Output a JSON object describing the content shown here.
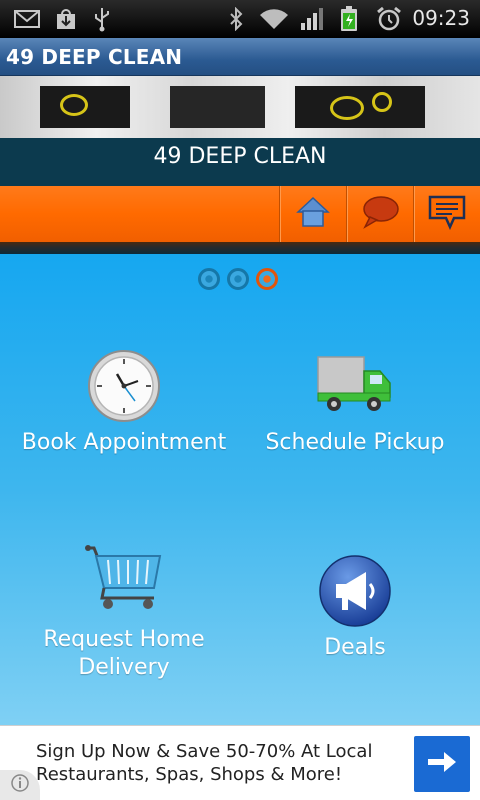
{
  "status_bar": {
    "icons": [
      "gmail-icon",
      "download-icon",
      "usb-icon",
      "bluetooth-icon",
      "wifi-icon",
      "signal-icon",
      "battery-charging-icon",
      "alarm-icon"
    ],
    "time": "09:23"
  },
  "app": {
    "title": "49 DEEP CLEAN"
  },
  "banner": {
    "business_name": "49 DEEP CLEAN"
  },
  "toolbar": {
    "buttons": [
      "home-icon",
      "chat-bubble-icon",
      "message-icon"
    ]
  },
  "pager": {
    "count": 3,
    "active_index": 2
  },
  "menu": {
    "items": [
      {
        "label": "Book Appointment",
        "icon": "clock-icon"
      },
      {
        "label": "Schedule Pickup",
        "icon": "truck-icon"
      },
      {
        "label": "Request Home Delivery",
        "icon": "shopping-cart-icon"
      },
      {
        "label": "Deals",
        "icon": "megaphone-icon"
      }
    ]
  },
  "ad": {
    "text": "Sign Up Now & Save 50-70% At Local Restaurants, Spas, Shops & More!"
  },
  "colors": {
    "title_bar": "#2b5a92",
    "toolbar_orange": "#ff6a00",
    "main_blue": "#3eb6ee",
    "ad_button": "#1a6ad3"
  }
}
